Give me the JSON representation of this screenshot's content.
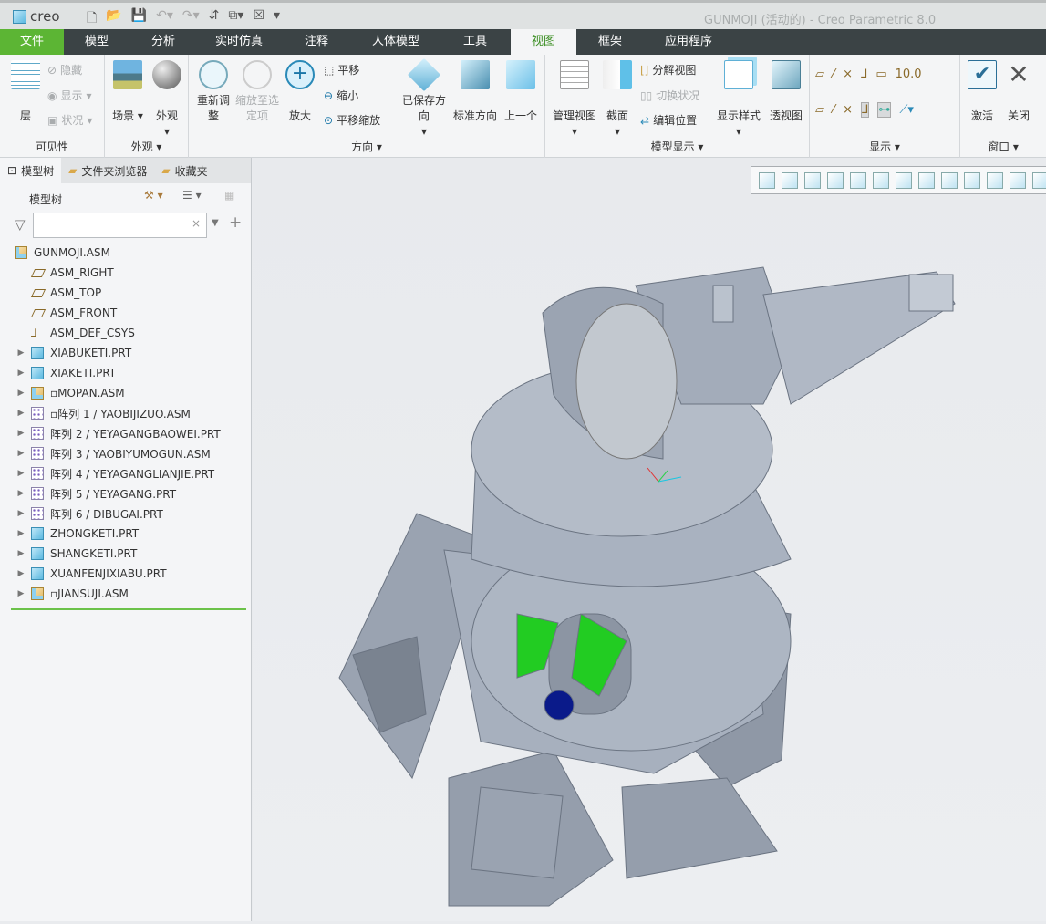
{
  "app": {
    "logo": "creo",
    "title": "GUNMOJI (活动的) - Creo Parametric 8.0"
  },
  "quick_access": [
    "new-icon",
    "open-icon",
    "save-icon",
    "undo-icon",
    "redo-icon",
    "regenerate-icon",
    "windows-icon",
    "close-window-icon",
    "customize-icon"
  ],
  "tabs": [
    "文件",
    "模型",
    "分析",
    "实时仿真",
    "注释",
    "人体模型",
    "工具",
    "视图",
    "框架",
    "应用程序"
  ],
  "active_tab": "视图",
  "ribbon": {
    "visibility": {
      "label": "可见性",
      "layer": "层",
      "hide": "隐藏",
      "show": "显示",
      "status": "状况"
    },
    "appearance": {
      "label": "外观",
      "scene": "场景",
      "appearance": "外观"
    },
    "orientation": {
      "label": "方向",
      "refit": "重新调整",
      "zoom_selected": "缩放至选定项",
      "zoom_in": "放大",
      "pan": "平移",
      "zoom_out": "缩小",
      "pan_zoom": "平移缩放",
      "saved_orient": "已保存方向",
      "standard_orient": "标准方向",
      "previous": "上一个"
    },
    "model_display": {
      "label": "模型显示",
      "manage_views": "管理视图",
      "section": "截面",
      "explode": "分解视图",
      "toggle_status": "切换状况",
      "edit_position": "编辑位置",
      "display_style": "显示样式",
      "perspective": "透视图"
    },
    "show": {
      "label": "显示"
    },
    "window": {
      "label": "窗口",
      "activate": "激活",
      "close": "关闭"
    }
  },
  "panel": {
    "tabs": [
      "模型树",
      "文件夹浏览器",
      "收藏夹"
    ],
    "header": "模型树",
    "filter_value": "",
    "tree": [
      {
        "label": "GUNMOJI.ASM",
        "icon": "assembly",
        "level": 0,
        "expandable": false
      },
      {
        "label": "ASM_RIGHT",
        "icon": "plane",
        "level": 1,
        "expandable": false
      },
      {
        "label": "ASM_TOP",
        "icon": "plane",
        "level": 1,
        "expandable": false
      },
      {
        "label": "ASM_FRONT",
        "icon": "plane",
        "level": 1,
        "expandable": false
      },
      {
        "label": "ASM_DEF_CSYS",
        "icon": "csys",
        "level": 1,
        "expandable": false
      },
      {
        "label": "XIABUKETI.PRT",
        "icon": "part",
        "level": 1,
        "expandable": true
      },
      {
        "label": "XIAKETI.PRT",
        "icon": "part",
        "level": 1,
        "expandable": true
      },
      {
        "label": "▫MOPAN.ASM",
        "icon": "assembly",
        "level": 1,
        "expandable": true
      },
      {
        "label": "▫阵列 1 / YAOBIJIZUO.ASM",
        "icon": "pattern",
        "level": 1,
        "expandable": true
      },
      {
        "label": "阵列 2 / YEYAGANGBAOWEI.PRT",
        "icon": "pattern",
        "level": 1,
        "expandable": true
      },
      {
        "label": "阵列 3 / YAOBIYUMOGUN.ASM",
        "icon": "pattern",
        "level": 1,
        "expandable": true
      },
      {
        "label": "阵列 4 / YEYAGANGLIANJIE.PRT",
        "icon": "pattern",
        "level": 1,
        "expandable": true
      },
      {
        "label": "阵列 5 / YEYAGANG.PRT",
        "icon": "pattern",
        "level": 1,
        "expandable": true
      },
      {
        "label": "阵列 6 / DIBUGAI.PRT",
        "icon": "pattern",
        "level": 1,
        "expandable": true
      },
      {
        "label": "ZHONGKETI.PRT",
        "icon": "part",
        "level": 1,
        "expandable": true
      },
      {
        "label": "SHANGKETI.PRT",
        "icon": "part",
        "level": 1,
        "expandable": true
      },
      {
        "label": "XUANFENJIXIABU.PRT",
        "icon": "part",
        "level": 1,
        "expandable": true
      },
      {
        "label": "▫JIANSUJI.ASM",
        "icon": "assembly",
        "level": 1,
        "expandable": true
      }
    ]
  },
  "view_toolbar": [
    "refit-icon",
    "zoom-in-icon",
    "zoom-out-icon",
    "repaint-icon",
    "shading-icon",
    "display-style-icon",
    "saved-orient-icon",
    "manage-views-icon",
    "perspective-icon",
    "plane-display-icon",
    "csys-display-icon",
    "annotation-display-icon",
    "spin-center-icon"
  ],
  "colors": {
    "accent": "#5cb534",
    "tabbar": "#3b4345",
    "model": "#a7b0be"
  }
}
